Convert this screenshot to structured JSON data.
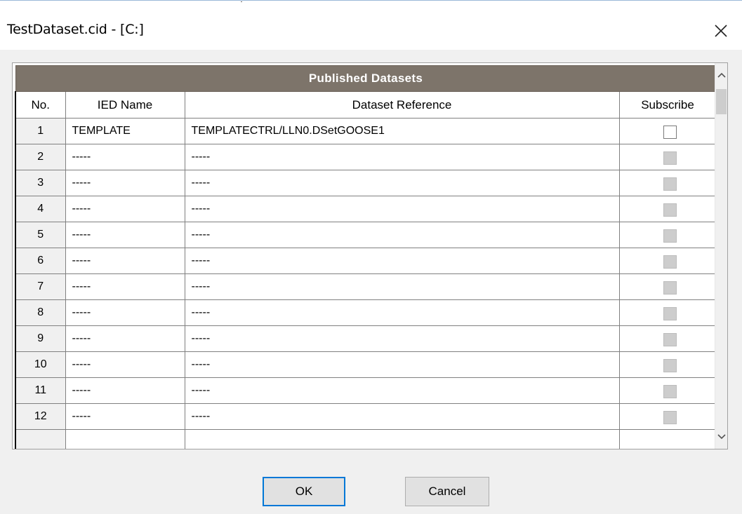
{
  "window": {
    "title": "TestDataset.cid - [C:]"
  },
  "grid": {
    "title": "Published Datasets",
    "headers": {
      "no": "No.",
      "ied_name": "IED Name",
      "dataset_reference": "Dataset Reference",
      "subscribe": "Subscribe"
    },
    "rows": [
      {
        "no": "1",
        "ied_name": "TEMPLATE",
        "dataset_reference": "TEMPLATECTRL/LLN0.DSetGOOSE1",
        "subscribe_checked": false,
        "subscribe_enabled": true
      },
      {
        "no": "2",
        "ied_name": "-----",
        "dataset_reference": "-----",
        "subscribe_checked": false,
        "subscribe_enabled": false
      },
      {
        "no": "3",
        "ied_name": "-----",
        "dataset_reference": "-----",
        "subscribe_checked": false,
        "subscribe_enabled": false
      },
      {
        "no": "4",
        "ied_name": "-----",
        "dataset_reference": "-----",
        "subscribe_checked": false,
        "subscribe_enabled": false
      },
      {
        "no": "5",
        "ied_name": "-----",
        "dataset_reference": "-----",
        "subscribe_checked": false,
        "subscribe_enabled": false
      },
      {
        "no": "6",
        "ied_name": "-----",
        "dataset_reference": "-----",
        "subscribe_checked": false,
        "subscribe_enabled": false
      },
      {
        "no": "7",
        "ied_name": "-----",
        "dataset_reference": "-----",
        "subscribe_checked": false,
        "subscribe_enabled": false
      },
      {
        "no": "8",
        "ied_name": "-----",
        "dataset_reference": "-----",
        "subscribe_checked": false,
        "subscribe_enabled": false
      },
      {
        "no": "9",
        "ied_name": "-----",
        "dataset_reference": "-----",
        "subscribe_checked": false,
        "subscribe_enabled": false
      },
      {
        "no": "10",
        "ied_name": "-----",
        "dataset_reference": "-----",
        "subscribe_checked": false,
        "subscribe_enabled": false
      },
      {
        "no": "11",
        "ied_name": "-----",
        "dataset_reference": "-----",
        "subscribe_checked": false,
        "subscribe_enabled": false
      },
      {
        "no": "12",
        "ied_name": "-----",
        "dataset_reference": "-----",
        "subscribe_checked": false,
        "subscribe_enabled": false
      },
      {
        "no": "",
        "ied_name": "",
        "dataset_reference": "",
        "subscribe_checked": false,
        "subscribe_enabled": false
      }
    ]
  },
  "buttons": {
    "ok": "OK",
    "cancel": "Cancel"
  },
  "icons": {
    "close": "close-icon",
    "scroll_up": "chevron-up-icon",
    "scroll_down": "chevron-down-icon"
  }
}
